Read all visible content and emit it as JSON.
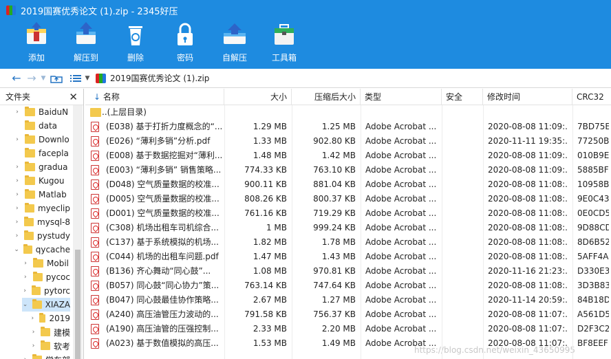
{
  "window": {
    "title": "2019国赛优秀论文 (1).zip - 2345好压"
  },
  "toolbar": [
    {
      "name": "add-button",
      "icon": "add-archive-icon",
      "label": "添加"
    },
    {
      "name": "extract-to-button",
      "icon": "extract-icon",
      "label": "解压到"
    },
    {
      "name": "delete-button",
      "icon": "trash-icon",
      "label": "删除"
    },
    {
      "name": "password-button",
      "icon": "lock-icon",
      "label": "密码"
    },
    {
      "name": "self-extract-button",
      "icon": "self-extract-icon",
      "label": "自解压"
    },
    {
      "name": "toolbox-button",
      "icon": "toolbox-icon",
      "label": "工具箱"
    }
  ],
  "address": {
    "path": "2019国赛优秀论文 (1).zip"
  },
  "left_pane": {
    "title": "文件夹",
    "items": [
      {
        "label": "BaiduN",
        "level": 0,
        "arrow": "›"
      },
      {
        "label": "data",
        "level": 0,
        "arrow": ""
      },
      {
        "label": "Downlo",
        "level": 0,
        "arrow": "›"
      },
      {
        "label": "facepla",
        "level": 0,
        "arrow": ""
      },
      {
        "label": "gradua",
        "level": 0,
        "arrow": "›"
      },
      {
        "label": "Kugou",
        "level": 0,
        "arrow": "›"
      },
      {
        "label": "Matlab",
        "level": 0,
        "arrow": "›"
      },
      {
        "label": "myeclip",
        "level": 0,
        "arrow": "›"
      },
      {
        "label": "mysql-8",
        "level": 0,
        "arrow": "›"
      },
      {
        "label": "pystudy",
        "level": 0,
        "arrow": "›"
      },
      {
        "label": "qycache",
        "level": 0,
        "arrow": "⌄"
      },
      {
        "label": "Mobil",
        "level": 1,
        "arrow": "›"
      },
      {
        "label": "pycoc",
        "level": 1,
        "arrow": "›"
      },
      {
        "label": "pytorc",
        "level": 1,
        "arrow": "›"
      },
      {
        "label": "XIAZA",
        "level": 1,
        "arrow": "⌄",
        "selected": true
      },
      {
        "label": "2019",
        "level": 2,
        "arrow": "›"
      },
      {
        "label": "建模",
        "level": 2,
        "arrow": "›"
      },
      {
        "label": "软考",
        "level": 2,
        "arrow": "›"
      },
      {
        "label": "学车部",
        "level": 1,
        "arrow": "›"
      }
    ]
  },
  "list": {
    "sort_indicator": "↓",
    "columns": [
      "名称",
      "大小",
      "压缩后大小",
      "类型",
      "安全",
      "修改时间",
      "CRC32"
    ],
    "parent_label": "..(上层目录)",
    "rows": [
      {
        "name": "(E038) 基于打折力度概念的“...",
        "size": "1.29 MB",
        "packed": "1.25 MB",
        "type": "Adobe Acrobat ...",
        "time": "2020-08-08 11:09:...",
        "crc": "7BD75E"
      },
      {
        "name": "(E026) “薄利多销”分析.pdf",
        "size": "1.33 MB",
        "packed": "902.80 KB",
        "type": "Adobe Acrobat ...",
        "time": "2020-11-11 19:35:...",
        "crc": "77250B"
      },
      {
        "name": "(E008) 基于数据挖掘对“薄利...",
        "size": "1.48 MB",
        "packed": "1.42 MB",
        "type": "Adobe Acrobat ...",
        "time": "2020-08-08 11:09:...",
        "crc": "010B9E"
      },
      {
        "name": "(E003) “薄利多销” 销售策略...",
        "size": "774.33 KB",
        "packed": "763.10 KB",
        "type": "Adobe Acrobat ...",
        "time": "2020-08-08 11:09:...",
        "crc": "5885BF"
      },
      {
        "name": "(D048) 空气质量数据的校准...",
        "size": "900.11 KB",
        "packed": "881.04 KB",
        "type": "Adobe Acrobat ...",
        "time": "2020-08-08 11:08:...",
        "crc": "10958B"
      },
      {
        "name": "(D005) 空气质量数据的校准...",
        "size": "808.26 KB",
        "packed": "800.37 KB",
        "type": "Adobe Acrobat ...",
        "time": "2020-08-08 11:08:...",
        "crc": "9E0C43"
      },
      {
        "name": "(D001) 空气质量数据的校准...",
        "size": "761.16 KB",
        "packed": "719.29 KB",
        "type": "Adobe Acrobat ...",
        "time": "2020-08-08 11:08:...",
        "crc": "0E0CD5"
      },
      {
        "name": "(C308) 机场出租车司机综合...",
        "size": "1 MB",
        "packed": "999.24 KB",
        "type": "Adobe Acrobat ...",
        "time": "2020-08-08 11:08:...",
        "crc": "9D88CD"
      },
      {
        "name": "(C137) 基于系统模拟的机场...",
        "size": "1.82 MB",
        "packed": "1.78 MB",
        "type": "Adobe Acrobat ...",
        "time": "2020-08-08 11:08:...",
        "crc": "8D6B52"
      },
      {
        "name": "(C044) 机场的出租车问题.pdf",
        "size": "1.47 MB",
        "packed": "1.43 MB",
        "type": "Adobe Acrobat ...",
        "time": "2020-08-08 11:08:...",
        "crc": "5AFF4A"
      },
      {
        "name": "(B136) 齐心舞动“同心鼓”...",
        "size": "1.08 MB",
        "packed": "970.81 KB",
        "type": "Adobe Acrobat ...",
        "time": "2020-11-16 21:23:...",
        "crc": "D330E3"
      },
      {
        "name": "(B057) 同心鼓“同心协力”策...",
        "size": "763.14 KB",
        "packed": "747.64 KB",
        "type": "Adobe Acrobat ...",
        "time": "2020-08-08 11:08:...",
        "crc": "3D3B83"
      },
      {
        "name": "(B047) 同心鼓最佳协作策略...",
        "size": "2.67 MB",
        "packed": "1.27 MB",
        "type": "Adobe Acrobat ...",
        "time": "2020-11-14 20:59:...",
        "crc": "84B18D"
      },
      {
        "name": "(A240) 高压油管压力波动的...",
        "size": "791.58 KB",
        "packed": "756.37 KB",
        "type": "Adobe Acrobat ...",
        "time": "2020-08-08 11:07:...",
        "crc": "A561D5"
      },
      {
        "name": "(A190) 高压油管的压强控制...",
        "size": "2.33 MB",
        "packed": "2.20 MB",
        "type": "Adobe Acrobat ...",
        "time": "2020-08-08 11:07:...",
        "crc": "D2F3C2"
      },
      {
        "name": "(A023) 基于数值模拟的高压...",
        "size": "1.53 MB",
        "packed": "1.49 MB",
        "type": "Adobe Acrobat ...",
        "time": "2020-08-08 11:07:...",
        "crc": "BF8EEF"
      }
    ]
  },
  "watermark": "https://blog.csdn.net/weixin_43650995"
}
